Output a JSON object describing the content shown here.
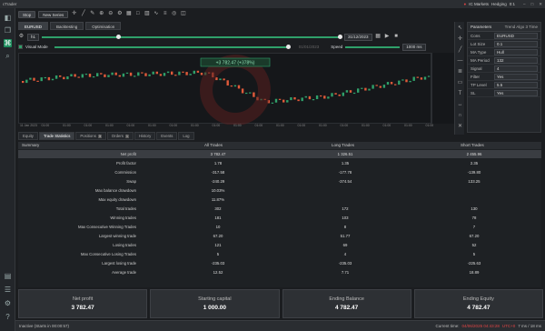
{
  "titlebar": {
    "app": "cTrader",
    "broker": "IC Markets",
    "status": "Hedging",
    "time": "0:1"
  },
  "toolbar": {
    "buttons": [
      "Stop",
      "New Series"
    ]
  },
  "tabs": [
    "EURUSD",
    "Backtesting",
    "Optimisation"
  ],
  "settings": {
    "timeframe": "h1",
    "from": "01/01/2023",
    "to": "31/12/2023",
    "speed_label": "Speed",
    "speed_value": "1000 ms"
  },
  "visual_mode": {
    "label": "Visual Mode",
    "balance_tag": "+3 782.47 (+378%)"
  },
  "xaxis": [
    "11 Jan 2023",
    "01:00",
    "01:00",
    "01:00",
    "01:00",
    "01:00",
    "01:00",
    "01:00",
    "01:00",
    "01:00",
    "01:00",
    "01:00",
    "01:00",
    "01:00",
    "01:00",
    "01:00",
    "01:00",
    "01:00",
    "01:00",
    "01:00"
  ],
  "params": {
    "header": "Parameters",
    "header_value": "Trend Algo 3 Time",
    "rows": [
      {
        "k": "Cons",
        "v": "EURUSD"
      },
      {
        "k": "Lot Size",
        "v": "0.1"
      },
      {
        "k": "MA Type",
        "v": "Hull"
      },
      {
        "k": "MA Period",
        "v": "132"
      },
      {
        "k": "Signal",
        "v": "4"
      },
      {
        "k": "Filter",
        "v": "Yes"
      },
      {
        "k": "TP Level",
        "v": "5.5"
      },
      {
        "k": "SL",
        "v": "Yes"
      }
    ]
  },
  "bottom_tabs": [
    {
      "label": "Equity",
      "count": ""
    },
    {
      "label": "Trade Statistics",
      "count": ""
    },
    {
      "label": "Positions",
      "count": "3"
    },
    {
      "label": "Orders",
      "count": "1"
    },
    {
      "label": "History",
      "count": ""
    },
    {
      "label": "Events",
      "count": ""
    },
    {
      "label": "Log",
      "count": ""
    }
  ],
  "table": {
    "headers": [
      "Summary",
      "All Trades",
      "Long Trades",
      "Short Trades"
    ],
    "rows": [
      {
        "label": "Net profit",
        "all": "3 782.47",
        "long": "1 326.51",
        "short": "2 455.96",
        "hl": true
      },
      {
        "label": "Profit factor",
        "all": "1.78",
        "long": "1.35",
        "short": "2.35",
        "hl": false
      },
      {
        "label": "Commission",
        "all": "-317.58",
        "long": "-177.78",
        "short": "-139.80",
        "hl": false
      },
      {
        "label": "Swap",
        "all": "-240.29",
        "long": "-374.54",
        "short": "133.25",
        "hl": false
      },
      {
        "label": "Max balance drawdown",
        "all": "10.03%",
        "long": "",
        "short": "",
        "hl": false
      },
      {
        "label": "Max equity drawdown",
        "all": "11.87%",
        "long": "",
        "short": "",
        "hl": false
      },
      {
        "label": "Total trades",
        "all": "302",
        "long": "172",
        "short": "130",
        "hl": false
      },
      {
        "label": "Winning trades",
        "all": "181",
        "long": "103",
        "short": "78",
        "hl": false
      },
      {
        "label": "Max Consecutive Winning Trades",
        "all": "10",
        "long": "8",
        "short": "7",
        "hl": false
      },
      {
        "label": "Largest winning trade",
        "all": "67.20",
        "long": "51.77",
        "short": "67.20",
        "hl": false
      },
      {
        "label": "Losing trades",
        "all": "121",
        "long": "69",
        "short": "52",
        "hl": false
      },
      {
        "label": "Max Consecutive Losing Trades",
        "all": "5",
        "long": "4",
        "short": "5",
        "hl": false
      },
      {
        "label": "Largest losing trade",
        "all": "-235.03",
        "long": "-235.03",
        "short": "-225.63",
        "hl": false
      },
      {
        "label": "Average trade",
        "all": "12.52",
        "long": "7.71",
        "short": "18.89",
        "hl": false
      }
    ]
  },
  "summary": [
    {
      "label": "Net profit",
      "value": "3 782.47"
    },
    {
      "label": "Starting capital",
      "value": "1 000.00"
    },
    {
      "label": "Ending Balance",
      "value": "4 782.47"
    },
    {
      "label": "Ending Equity",
      "value": "4 782.47"
    }
  ],
  "statusbar": {
    "left": "Inactive (Starts in 00:00:57)",
    "current_time_label": "Current time:",
    "current_time": "04/06/2025 04:43:28",
    "tz": "UTC+0",
    "latency": "7 ms / 18 ms"
  },
  "colors": {
    "bull": "#2fa06a",
    "bear": "#e05a3a",
    "accent": "#1f8f5f"
  }
}
